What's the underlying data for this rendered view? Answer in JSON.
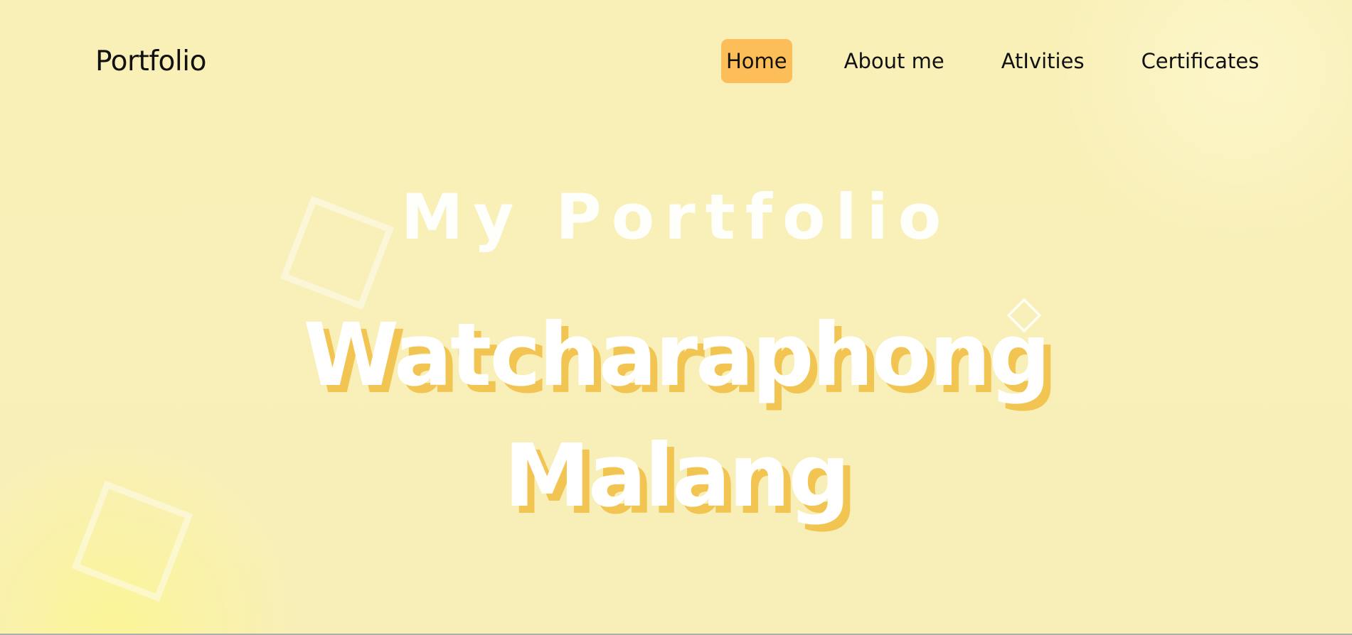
{
  "header": {
    "brand": "Portfolio",
    "nav": [
      {
        "label": "Home",
        "active": true
      },
      {
        "label": "About me",
        "active": false
      },
      {
        "label": "AtIvities",
        "active": false
      },
      {
        "label": "Certificates",
        "active": false
      }
    ]
  },
  "hero": {
    "kicker": "My Portfolio",
    "name_line1": "Watcharaphong",
    "name_line2": "Malang"
  },
  "colors": {
    "background": "#f9f0b8",
    "accent": "#fdbd58",
    "text_shadow": "#f2c451",
    "hero_text": "#ffffff"
  }
}
